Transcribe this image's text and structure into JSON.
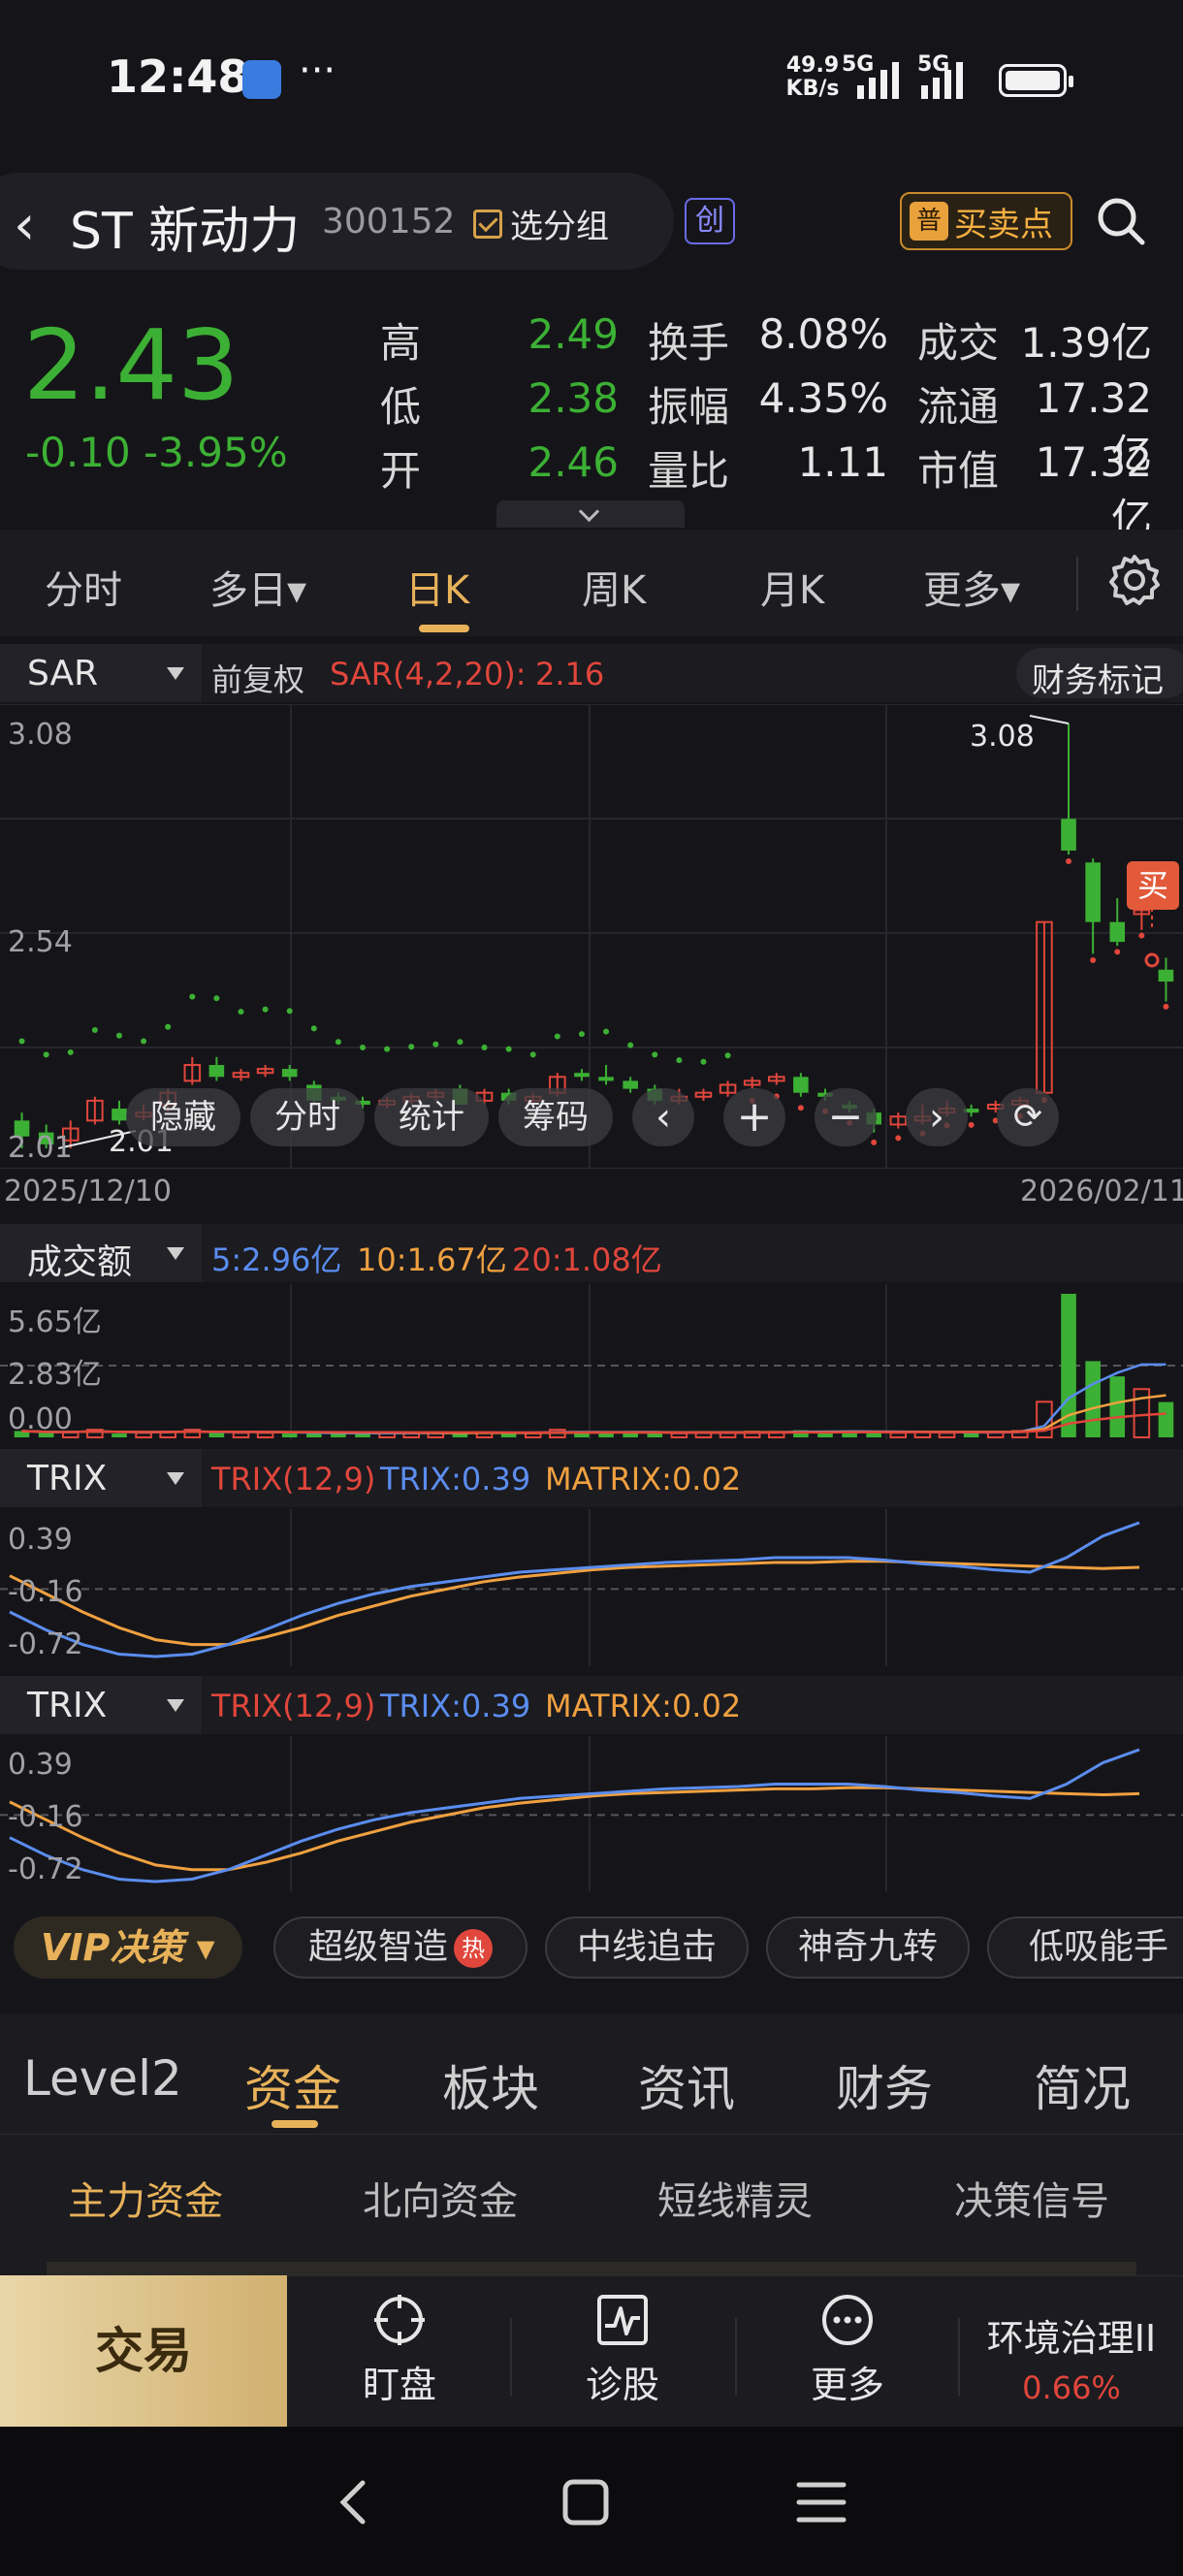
{
  "status_bar": {
    "time": "12:48",
    "speed_value": "49.9",
    "speed_unit": "KB/s",
    "net1": "5G",
    "net2": "5G"
  },
  "header": {
    "back": "‹",
    "name": "ST 新动力",
    "code": "300152",
    "group_label": "选分组",
    "board_badge": "创",
    "buysell_icon": "普",
    "buysell_label": "买卖点"
  },
  "quote": {
    "price": "2.43",
    "change": "-0.10",
    "change_pct": "-3.95%",
    "rows": [
      {
        "l1": "高",
        "v1": "2.49",
        "l2": "换手",
        "v2": "8.08%",
        "l3": "成交",
        "v3": "1.39亿"
      },
      {
        "l1": "低",
        "v1": "2.38",
        "l2": "振幅",
        "v2": "4.35%",
        "l3": "流通",
        "v3": "17.32亿"
      },
      {
        "l1": "开",
        "v1": "2.46",
        "l2": "量比",
        "v2": "1.11",
        "l3": "市值",
        "v3": "17.32亿"
      }
    ]
  },
  "period_tabs": [
    "分时",
    "多日▾",
    "日K",
    "周K",
    "月K",
    "更多▾"
  ],
  "main_indicator": {
    "name": "SAR",
    "adjust": "前复权",
    "params": "SAR(4,2,20):",
    "value": "2.16",
    "fin_mark": "财务标记"
  },
  "price_axis": {
    "top": "3.08",
    "mid": "2.54",
    "bottom": "2.01"
  },
  "annotations": {
    "high": "3.08",
    "low": "2.01",
    "buy": "买"
  },
  "date_axis": {
    "start": "2025/12/10",
    "end": "2026/02/11"
  },
  "float_buttons": {
    "hide": "隐藏",
    "timeshare": "分时",
    "stats": "统计",
    "chips": "筹码"
  },
  "volume_indicator": {
    "name": "成交额",
    "ma5": "5:2.96亿",
    "ma10": "10:1.67亿",
    "ma20": "20:1.08亿",
    "axis_top": "5.65亿",
    "axis_mid": "2.83亿",
    "axis_bot": "0.00"
  },
  "trix1": {
    "name": "TRIX",
    "params": "TRIX(12,9)",
    "trix": "TRIX:0.39",
    "matrix": "MATRIX:0.02",
    "axis_top": "0.39",
    "axis_mid": "-0.16",
    "axis_bot": "-0.72"
  },
  "trix2": {
    "name": "TRIX",
    "params": "TRIX(12,9)",
    "trix": "TRIX:0.39",
    "matrix": "MATRIX:0.02",
    "axis_top": "0.39",
    "axis_mid": "-0.16",
    "axis_bot": "-0.72"
  },
  "vip": {
    "label": "VIP决策 ▾",
    "chips": [
      "超级智造",
      "中线追击",
      "神奇九转",
      "低吸能手"
    ],
    "hot": "热"
  },
  "bottom_tabs": [
    "Level2",
    "资金",
    "板块",
    "资讯",
    "财务",
    "简况"
  ],
  "sub_tabs": [
    "主力资金",
    "北向资金",
    "短线精灵",
    "决策信号"
  ],
  "bottom_nav": {
    "trade": "交易",
    "watch": "盯盘",
    "diagnose": "诊股",
    "more": "更多",
    "sector_name": "环境治理II",
    "sector_pct": "0.66%"
  },
  "colors": {
    "up": "#e0463b",
    "down": "#3cb034",
    "accent": "#e8b25a",
    "trix": "#5b8def",
    "matrix": "#f0a040"
  },
  "chart_data": {
    "type": "candlestick",
    "ylim": [
      2.01,
      3.08
    ],
    "candles": [
      [
        2.08,
        2.04,
        2.1,
        2.01,
        "d"
      ],
      [
        2.05,
        2.02,
        2.07,
        2.01,
        "d"
      ],
      [
        2.03,
        2.06,
        2.08,
        2.01,
        "u"
      ],
      [
        2.08,
        2.13,
        2.14,
        2.07,
        "u"
      ],
      [
        2.11,
        2.08,
        2.13,
        2.07,
        "d"
      ],
      [
        2.09,
        2.1,
        2.12,
        2.08,
        "u"
      ],
      [
        2.12,
        2.15,
        2.16,
        2.1,
        "u"
      ],
      [
        2.18,
        2.22,
        2.24,
        2.17,
        "u"
      ],
      [
        2.22,
        2.19,
        2.24,
        2.18,
        "d"
      ],
      [
        2.19,
        2.2,
        2.21,
        2.18,
        "u"
      ],
      [
        2.2,
        2.21,
        2.22,
        2.19,
        "u"
      ],
      [
        2.21,
        2.19,
        2.22,
        2.18,
        "d"
      ],
      [
        2.17,
        2.13,
        2.18,
        2.12,
        "d"
      ],
      [
        2.14,
        2.13,
        2.15,
        2.12,
        "d"
      ],
      [
        2.13,
        2.12,
        2.14,
        2.11,
        "d"
      ],
      [
        2.12,
        2.13,
        2.14,
        2.11,
        "u"
      ],
      [
        2.13,
        2.14,
        2.15,
        2.12,
        "u"
      ],
      [
        2.14,
        2.15,
        2.16,
        2.13,
        "u"
      ],
      [
        2.16,
        2.12,
        2.17,
        2.12,
        "d"
      ],
      [
        2.13,
        2.15,
        2.16,
        2.12,
        "u"
      ],
      [
        2.15,
        2.13,
        2.16,
        2.12,
        "d"
      ],
      [
        2.13,
        2.14,
        2.15,
        2.12,
        "u"
      ],
      [
        2.15,
        2.19,
        2.2,
        2.14,
        "u"
      ],
      [
        2.2,
        2.19,
        2.21,
        2.18,
        "d"
      ],
      [
        2.19,
        2.18,
        2.22,
        2.17,
        "d"
      ],
      [
        2.18,
        2.16,
        2.19,
        2.15,
        "d"
      ],
      [
        2.16,
        2.13,
        2.17,
        2.12,
        "d"
      ],
      [
        2.13,
        2.14,
        2.16,
        2.12,
        "u"
      ],
      [
        2.14,
        2.15,
        2.16,
        2.13,
        "u"
      ],
      [
        2.15,
        2.17,
        2.18,
        2.14,
        "u"
      ],
      [
        2.17,
        2.18,
        2.19,
        2.16,
        "u"
      ],
      [
        2.18,
        2.19,
        2.2,
        2.17,
        "u"
      ],
      [
        2.19,
        2.15,
        2.2,
        2.14,
        "d"
      ],
      [
        2.15,
        2.14,
        2.16,
        2.13,
        "d"
      ],
      [
        2.12,
        2.11,
        2.13,
        2.1,
        "d"
      ],
      [
        2.1,
        2.07,
        2.11,
        2.05,
        "d"
      ],
      [
        2.07,
        2.09,
        2.1,
        2.06,
        "u"
      ],
      [
        2.08,
        2.09,
        2.12,
        2.07,
        "u"
      ],
      [
        2.1,
        2.11,
        2.13,
        2.09,
        "u"
      ],
      [
        2.11,
        2.1,
        2.12,
        2.09,
        "d"
      ],
      [
        2.11,
        2.12,
        2.13,
        2.1,
        "u"
      ],
      [
        2.12,
        2.13,
        2.14,
        2.11,
        "u"
      ],
      [
        2.15,
        2.58,
        2.58,
        2.15,
        "u"
      ],
      [
        2.84,
        2.76,
        3.08,
        2.75,
        "d"
      ],
      [
        2.73,
        2.58,
        2.74,
        2.5,
        "d"
      ],
      [
        2.58,
        2.53,
        2.64,
        2.52,
        "d"
      ],
      [
        2.6,
        2.61,
        2.66,
        2.56,
        "u"
      ],
      [
        2.46,
        2.43,
        2.49,
        2.38,
        "d"
      ]
    ],
    "volume": [
      0.25,
      0.18,
      0.2,
      0.3,
      0.15,
      0.18,
      0.22,
      0.3,
      0.2,
      0.18,
      0.18,
      0.15,
      0.2,
      0.15,
      0.16,
      0.18,
      0.16,
      0.2,
      0.18,
      0.2,
      0.18,
      0.16,
      0.3,
      0.2,
      0.18,
      0.2,
      0.18,
      0.16,
      0.2,
      0.2,
      0.22,
      0.2,
      0.28,
      0.22,
      0.25,
      0.2,
      0.18,
      0.22,
      0.18,
      0.2,
      0.2,
      0.25,
      1.4,
      5.65,
      3.0,
      2.4,
      1.9,
      1.39
    ],
    "trix": [
      -0.35,
      -0.5,
      -0.62,
      -0.7,
      -0.72,
      -0.7,
      -0.62,
      -0.5,
      -0.38,
      -0.28,
      -0.2,
      -0.14,
      -0.1,
      -0.06,
      -0.02,
      0.0,
      0.02,
      0.04,
      0.06,
      0.07,
      0.08,
      0.1,
      0.1,
      0.1,
      0.08,
      0.05,
      0.03,
      0.0,
      -0.02,
      0.1,
      0.28,
      0.39
    ],
    "matrix": [
      -0.05,
      -0.2,
      -0.35,
      -0.48,
      -0.58,
      -0.62,
      -0.62,
      -0.56,
      -0.48,
      -0.38,
      -0.3,
      -0.22,
      -0.16,
      -0.1,
      -0.06,
      -0.03,
      0.0,
      0.02,
      0.03,
      0.04,
      0.05,
      0.06,
      0.06,
      0.07,
      0.07,
      0.06,
      0.05,
      0.04,
      0.03,
      0.02,
      0.01,
      0.02
    ]
  }
}
